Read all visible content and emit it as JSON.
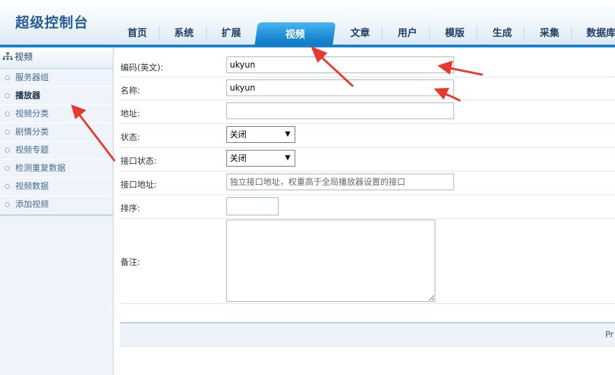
{
  "app": {
    "title": "超级控制台"
  },
  "nav": {
    "items": [
      {
        "label": "首页"
      },
      {
        "label": "系统"
      },
      {
        "label": "扩展"
      },
      {
        "label": "视频"
      },
      {
        "label": "文章"
      },
      {
        "label": "用户"
      },
      {
        "label": "模版"
      },
      {
        "label": "生成"
      },
      {
        "label": "采集"
      },
      {
        "label": "数据库"
      }
    ],
    "active": "视频"
  },
  "sidebar": {
    "heading": "视频",
    "items": [
      {
        "label": "服务器组"
      },
      {
        "label": "播放器"
      },
      {
        "label": "视频分类"
      },
      {
        "label": "剧情分类"
      },
      {
        "label": "视频专题"
      },
      {
        "label": "检测重复数据"
      },
      {
        "label": "视频数据"
      },
      {
        "label": "添加视频"
      }
    ],
    "active": "播放器"
  },
  "form": {
    "code": {
      "label": "编码(英文):",
      "value": "ukyun"
    },
    "name": {
      "label": "名称:",
      "value": "ukyun"
    },
    "address": {
      "label": "地址:",
      "value": ""
    },
    "status": {
      "label": "状态:",
      "value": "关闭"
    },
    "api_status": {
      "label": "接口状态:",
      "value": "关闭"
    },
    "api_address": {
      "label": "接口地址:",
      "placeholder": "独立接口地址，权重高于全局播放器设置的接口"
    },
    "sort": {
      "label": "排序:",
      "value": ""
    },
    "remark": {
      "label": "备注:",
      "value": ""
    }
  },
  "footer": {
    "text": "Pr"
  },
  "colors": {
    "brand_title": "#245d94",
    "nav_active": "#1e8fd8",
    "header_bar": "#1180d0",
    "annotation_arrow": "#e8392f"
  }
}
